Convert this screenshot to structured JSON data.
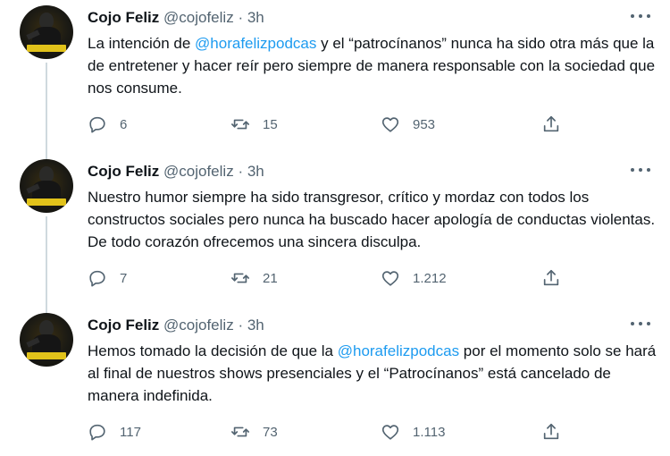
{
  "tweets": [
    {
      "name": "Cojo Feliz",
      "handle": "@cojofeliz",
      "dot": "·",
      "time": "3h",
      "text_before": "La intención de ",
      "mention": "@horafelizpodcas",
      "text_after": " y el “patrocínanos” nunca ha sido otra más que la de entretener y hacer reír pero siempre de manera responsable con la sociedad que nos consume.",
      "replies": "6",
      "retweets": "15",
      "likes": "953"
    },
    {
      "name": "Cojo Feliz",
      "handle": "@cojofeliz",
      "dot": "·",
      "time": "3h",
      "text_before": "Nuestro humor siempre ha sido transgresor, crítico y mordaz con todos los constructos sociales pero nunca ha buscado hacer apología de conductas violentas. De todo corazón ofrecemos una sincera disculpa.",
      "mention": "",
      "text_after": "",
      "replies": "7",
      "retweets": "21",
      "likes": "1.212"
    },
    {
      "name": "Cojo Feliz",
      "handle": "@cojofeliz",
      "dot": "·",
      "time": "3h",
      "text_before": "Hemos tomado la decisión de que la ",
      "mention": "@horafelizpodcas",
      "text_after": " por el momento solo se hará al final de nuestros shows presenciales y el “Patrocínanos” está cancelado de manera indefinida.",
      "replies": "117",
      "retweets": "73",
      "likes": "1.113"
    }
  ],
  "icons": {
    "reply": "reply-icon",
    "retweet": "retweet-icon",
    "like": "heart-icon",
    "share": "share-icon",
    "more": "more-icon"
  },
  "colors": {
    "text": "#0f1419",
    "muted": "#536471",
    "link": "#1d9bf0",
    "thread_line": "#cfd9de"
  }
}
